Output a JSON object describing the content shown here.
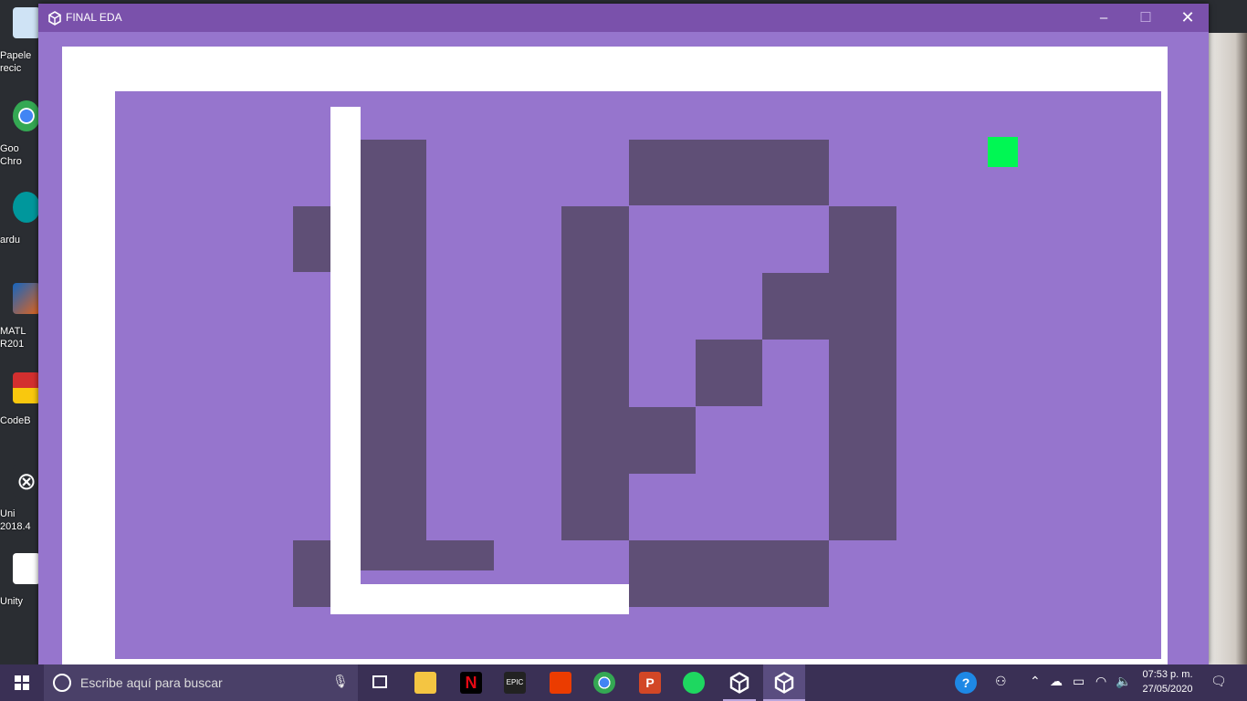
{
  "desktop": {
    "icons": [
      {
        "name": "recycle-bin",
        "label": "Papele\nrecic",
        "color": "#9fc6e8"
      },
      {
        "name": "google-chrome",
        "label": "Goo\nChro",
        "color": "#3a9f44"
      },
      {
        "name": "arduino",
        "label": "ardu",
        "color": "#00979c"
      },
      {
        "name": "matlab",
        "label": "MATL\nR201",
        "color": "#e3641b"
      },
      {
        "name": "codeblocks",
        "label": "CodeB",
        "color": "#d32f2f"
      },
      {
        "name": "unity-hub",
        "label": "Uni\n2018.4",
        "color": "#f2f2f2"
      },
      {
        "name": "unity",
        "label": "Unity",
        "color": "#ffffff"
      }
    ]
  },
  "window": {
    "title": "FINAL EDA",
    "controls": {
      "minimize": "–",
      "maximize": "☐",
      "close": "✕"
    }
  },
  "game": {
    "colors": {
      "background": "#9675cd",
      "border": "#ffffff",
      "obstacle": "#5f4f76",
      "snake": "#ffffff",
      "food": "#00f753"
    }
  },
  "taskbar": {
    "search_placeholder": "Escribe aquí para buscar",
    "apps": [
      "task-view",
      "file-explorer",
      "netflix",
      "epic-games",
      "office",
      "chrome",
      "powerpoint",
      "spotify",
      "unity",
      "unity-active"
    ],
    "epic_label": "EPIC",
    "clock_time": "07:53 p. m.",
    "clock_date": "27/05/2020"
  }
}
